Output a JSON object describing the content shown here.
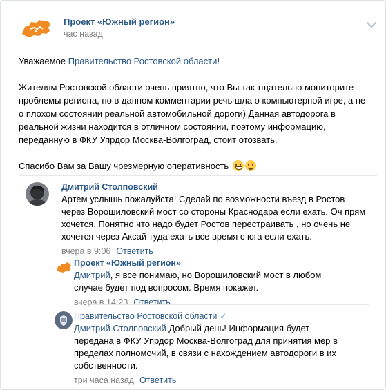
{
  "post": {
    "group_name": "Проект «Южный регион»",
    "time": "час назад",
    "greeting_prefix": "Уважаемое ",
    "greeting_link": "Правительство Ростовской области",
    "greeting_suffix": "!",
    "paragraph_1": "Жителям Ростовской области очень приятно, что Вы так тщательно мониторите проблемы региона, но в данном комментарии речь шла о компьютерной игре, а не о плохом состоянии реальной автомобильной дороги) Данная автодорога в реальной жизни находится в отличном состоянии, поэтому информацию, переданную в ФКУ Упрдор Москва-Волгоград, стоит отозвать.",
    "paragraph_2": "Спасибо Вам за Вашу чрезмерную оперативность"
  },
  "replies": [
    {
      "author": "Дмитрий Столповский",
      "mention": "",
      "text": "Артем услышь пожалуйста! Сделай по возможности въезд в Ростов через Ворошиловский мост со стороны Краснодара если ехать. Оч прям хочется. Понятно что надо будет Ростов перестраивать , но очень не хочется через Аксай туда ехать все время с юга если ехать.",
      "time": "вчера в 9:06",
      "action": "Ответить"
    },
    {
      "author": "Проект «Южный регион»",
      "mention": "Дмитрий",
      "text": ", я все понимаю, но Ворошиловский мост в любом случае будет под вопросом. Время покажет.",
      "time": "вчера в 14:23",
      "action": "Ответить"
    },
    {
      "author": "Правительство Ростовской области",
      "verified": "✓",
      "mention": "Дмитрий Столповский",
      "text": " Добрый день! Информация будет передана в ФКУ Упрдор Москва-Волгоград для принятия мер в пределах полномочий, в связи с нахождением автодороги в их собственности.",
      "time": "три часа назад",
      "action": "Ответить"
    }
  ],
  "icons": {
    "group_logo": "rostov-region-map-icon",
    "menu": "chevron-down-icon",
    "emoji_1": "grinning-face-emoji",
    "emoji_2": "smiling-face-emoji"
  },
  "colors": {
    "link": "#2a5885",
    "meta": "#828282",
    "brand_orange": "#f08a24",
    "verified": "#71aaeb"
  }
}
